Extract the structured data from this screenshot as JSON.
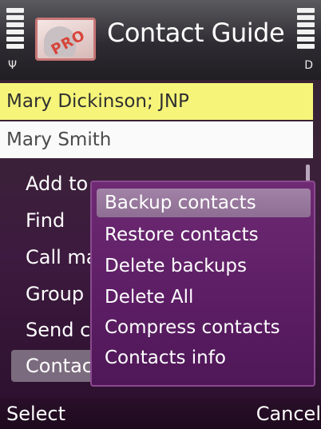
{
  "app": {
    "title": "Contact Guide",
    "logo_text": "PRO"
  },
  "status": {
    "signal_bars": 5,
    "battery_bars": 5,
    "antenna_glyph": "Ψ",
    "battery_glyph": "D"
  },
  "contacts": [
    {
      "name": "Mary Dickinson; JNP",
      "selected": true
    },
    {
      "name": "Mary Smith",
      "selected": false
    }
  ],
  "options_menu": {
    "items": [
      {
        "label": "Add to"
      },
      {
        "label": "Find"
      },
      {
        "label": "Call ma"
      },
      {
        "label": "Group"
      },
      {
        "label": "Send c"
      },
      {
        "label": "Contac",
        "highlighted": true
      }
    ]
  },
  "submenu": {
    "items": [
      {
        "label": "Backup contacts",
        "highlighted": true
      },
      {
        "label": "Restore contacts"
      },
      {
        "label": "Delete backups"
      },
      {
        "label": "Delete All"
      },
      {
        "label": "Compress contacts"
      },
      {
        "label": "Contacts info"
      }
    ]
  },
  "softkeys": {
    "left": "Select",
    "right": "Cancel"
  },
  "colors": {
    "selected_row": "#f6f57a",
    "submenu_bg": "#6e2a73",
    "highlight": "#a182a6"
  }
}
